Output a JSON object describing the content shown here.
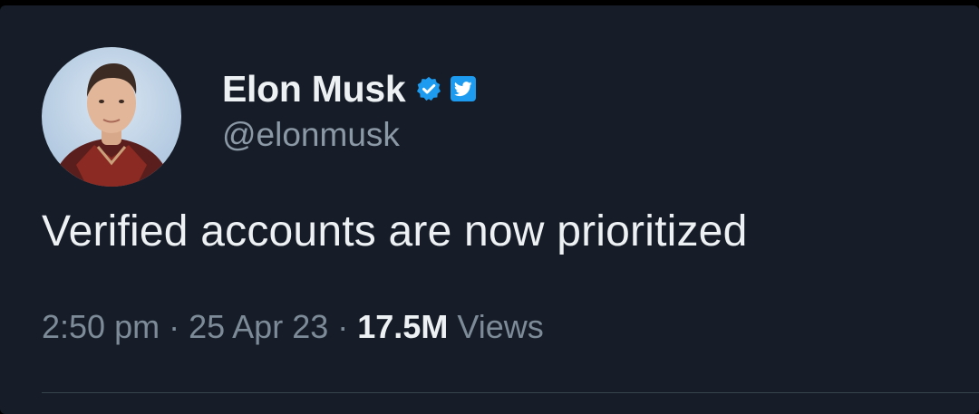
{
  "tweet": {
    "author": {
      "display_name": "Elon Musk",
      "handle": "@elonmusk",
      "avatar_icon": "profile-photo",
      "verified_icon": "verified-badge-icon",
      "app_icon": "twitter-bird-icon"
    },
    "text": "Verified accounts are now prioritized",
    "meta": {
      "time": "2:50 pm",
      "separator": "·",
      "date": "25 Apr 23",
      "views_count": "17.5M",
      "views_label": "Views"
    }
  },
  "colors": {
    "background": "#161d28",
    "primary_text": "#eef1f4",
    "secondary_text": "#8b98a5",
    "accent": "#1d9bf0"
  }
}
